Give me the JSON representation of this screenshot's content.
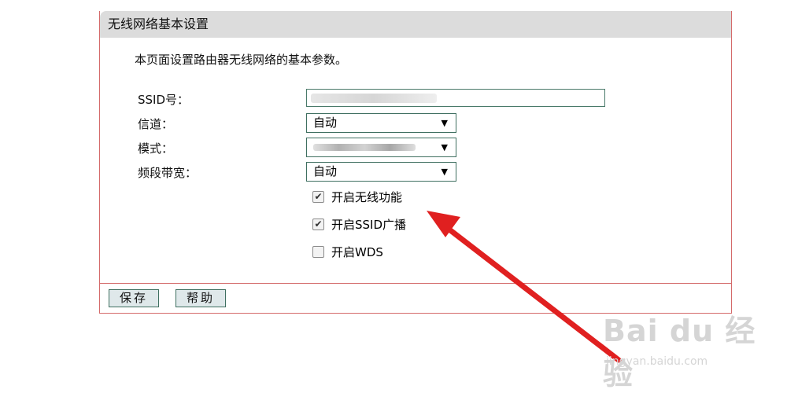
{
  "panel": {
    "title": "无线网络基本设置",
    "description": "本页面设置路由器无线网络的基本参数。"
  },
  "fields": {
    "ssid_label": "SSID号：",
    "channel_label": "信道：",
    "mode_label": "模式：",
    "bandwidth_label": "频段带宽："
  },
  "selects": {
    "channel_value": "自动",
    "bandwidth_value": "自动",
    "arrow": "▼"
  },
  "checkboxes": [
    {
      "label": "开启无线功能",
      "checked": true
    },
    {
      "label": "开启SSID广播",
      "checked": true
    },
    {
      "label": "开启WDS",
      "checked": false
    }
  ],
  "buttons": {
    "save": "保存",
    "help": "帮助"
  },
  "watermark": {
    "brand": "Bai du 经验",
    "url": "jingyan.baidu.com"
  },
  "colors": {
    "border": "#d46a6a",
    "header_bg": "#dcdcdc",
    "arrow_red": "#e02020"
  }
}
